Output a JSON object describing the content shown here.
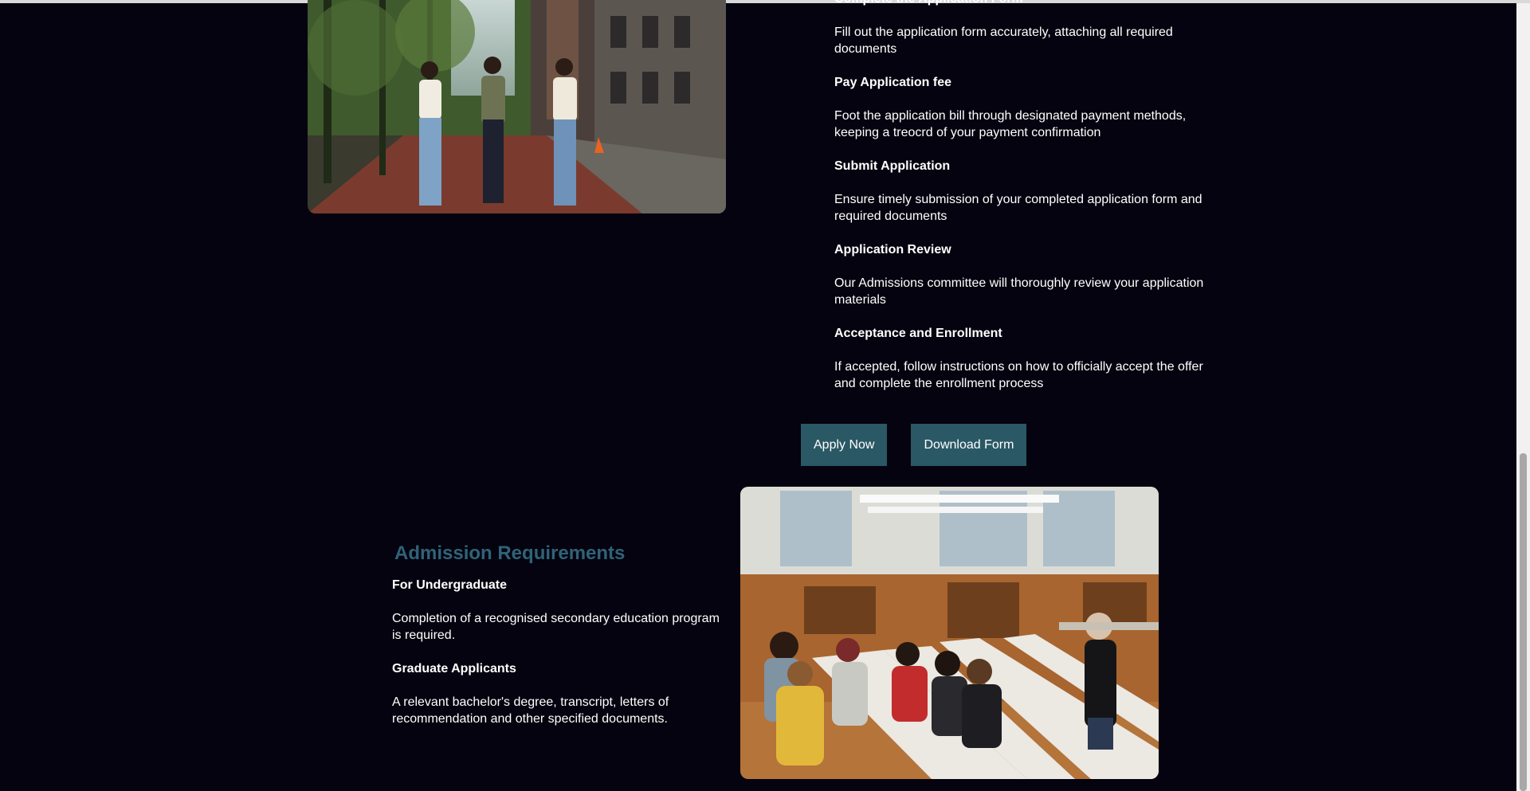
{
  "steps": [
    {
      "title": "Complete the Application Form",
      "desc": "Fill out the application form accurately, attaching all required documents"
    },
    {
      "title": "Pay Application fee",
      "desc": "Foot the application bill through designated payment methods, keeping a treocrd of your payment confirmation"
    },
    {
      "title": "Submit Application",
      "desc": "Ensure timely submission of your completed application form and required documents"
    },
    {
      "title": "Application Review",
      "desc": "Our Admissions committee will thoroughly review your application materials"
    },
    {
      "title": "Acceptance and Enrollment",
      "desc": "If accepted, follow instructions on how to officially accept the offer and complete the enrollment process"
    }
  ],
  "buttons": {
    "apply_label": "Apply Now",
    "download_label": "Download Form"
  },
  "requirements": {
    "heading": "Admission Requirements",
    "undergrad_title": "For Undergraduate",
    "undergrad_desc": "Completion of a recognised secondary education program is required.",
    "graduate_title": "Graduate Applicants",
    "graduate_desc": "A relevant bachelor's degree, transcript, letters of recommendation and other specified documents."
  },
  "colors": {
    "background": "#05030f",
    "button": "#2a5865",
    "heading": "#2f6379"
  }
}
